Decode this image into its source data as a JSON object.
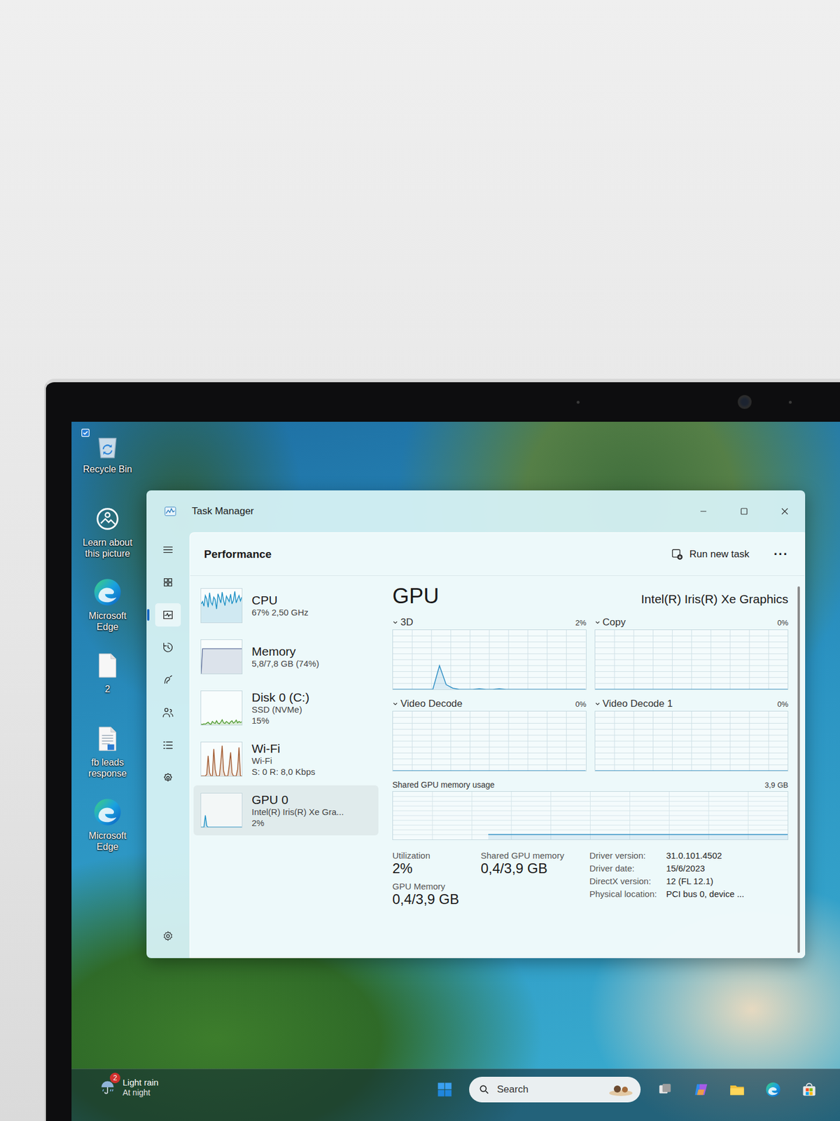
{
  "desktop": {
    "icons": [
      {
        "label": "Recycle Bin",
        "checked": true
      },
      {
        "label": "Learn about this picture",
        "checked": false
      },
      {
        "label": "Microsoft Edge",
        "checked": false
      },
      {
        "label": "2",
        "checked": false
      },
      {
        "label": "fb leads response",
        "checked": false
      },
      {
        "label": "Microsoft Edge",
        "checked": false
      }
    ]
  },
  "window": {
    "title": "Task Manager"
  },
  "nav_rail": [
    {
      "selected": false
    },
    {
      "selected": false
    },
    {
      "selected": true
    },
    {
      "selected": false
    },
    {
      "selected": false
    },
    {
      "selected": false
    },
    {
      "selected": false
    },
    {
      "selected": false
    }
  ],
  "header": {
    "title": "Performance",
    "action": "Run new task",
    "more": "···"
  },
  "resources": [
    {
      "name": "CPU",
      "details": [
        "67% 2,50 GHz"
      ],
      "color": "#1b8fc4",
      "selected": false,
      "values": [
        55,
        62,
        48,
        80,
        70,
        45,
        88,
        60,
        52,
        75,
        68,
        40,
        85,
        72,
        58,
        90,
        65,
        50,
        78,
        70,
        62,
        84,
        55,
        66,
        92,
        58,
        70,
        80,
        64,
        75
      ]
    },
    {
      "name": "Memory",
      "details": [
        "5,8/7,8 GB (74%)"
      ],
      "color": "#5d6f9a",
      "selected": false,
      "values": [
        0,
        74,
        74,
        74,
        74,
        74,
        74,
        74,
        74,
        74,
        74,
        74,
        74,
        74,
        74,
        74,
        74,
        74,
        74,
        74,
        74,
        74,
        74,
        74,
        74,
        74,
        74,
        74,
        74,
        74
      ]
    },
    {
      "name": "Disk 0 (C:)",
      "details": [
        "SSD (NVMe)",
        "15%"
      ],
      "color": "#4f9a2f",
      "selected": false,
      "values": [
        2,
        1,
        3,
        2,
        5,
        8,
        3,
        2,
        10,
        6,
        4,
        12,
        5,
        3,
        8,
        15,
        6,
        4,
        10,
        7,
        3,
        9,
        12,
        5,
        8,
        14,
        6,
        10,
        7,
        9
      ]
    },
    {
      "name": "Wi-Fi",
      "details": [
        "Wi-Fi",
        "S: 0 R: 8,0 Kbps"
      ],
      "color": "#a0562a",
      "selected": false,
      "values": [
        0,
        0,
        0,
        0,
        5,
        60,
        10,
        0,
        0,
        80,
        20,
        0,
        0,
        0,
        40,
        90,
        15,
        0,
        0,
        0,
        30,
        70,
        10,
        0,
        0,
        0,
        20,
        85,
        0,
        0
      ]
    },
    {
      "name": "GPU 0",
      "details": [
        "Intel(R) Iris(R) Xe Gra...",
        "2%"
      ],
      "color": "#1b8fc4",
      "selected": true,
      "values": [
        0,
        0,
        0,
        35,
        4,
        0,
        0,
        0,
        0,
        0,
        0,
        0,
        0,
        0,
        0,
        0,
        0,
        0,
        0,
        0,
        0,
        0,
        0,
        0,
        0,
        0,
        0,
        0,
        0,
        0
      ]
    }
  ],
  "detail": {
    "title": "GPU",
    "device": "Intel(R) Iris(R) Xe Graphics",
    "engines": [
      {
        "label": "3D",
        "reading": "2%",
        "values": [
          0,
          0,
          0,
          0,
          0,
          0,
          0,
          40,
          8,
          2,
          0,
          0,
          0,
          1,
          0,
          0,
          1,
          0,
          0,
          0,
          0,
          0,
          0,
          0,
          0,
          0,
          0,
          0,
          0,
          0
        ]
      },
      {
        "label": "Copy",
        "reading": "0%",
        "values": [
          0,
          0,
          0,
          0,
          0,
          0,
          0,
          0,
          0,
          0,
          0,
          0,
          0,
          0,
          0,
          0,
          0,
          0,
          0,
          0,
          0,
          0,
          0,
          0,
          0,
          0,
          0,
          0,
          0,
          0
        ]
      },
      {
        "label": "Video Decode",
        "reading": "0%",
        "values": [
          0,
          0,
          0,
          0,
          0,
          0,
          0,
          0,
          0,
          0,
          0,
          0,
          0,
          0,
          0,
          0,
          0,
          0,
          0,
          0,
          0,
          0,
          0,
          0,
          0,
          0,
          0,
          0,
          0,
          0
        ]
      },
      {
        "label": "Video Decode 1",
        "reading": "0%",
        "values": [
          0,
          0,
          0,
          0,
          0,
          0,
          0,
          0,
          0,
          0,
          0,
          0,
          0,
          0,
          0,
          0,
          0,
          0,
          0,
          0,
          0,
          0,
          0,
          0,
          0,
          0,
          0,
          0,
          0,
          0
        ]
      }
    ],
    "shared_memory_chart": {
      "label": "Shared GPU memory usage",
      "max_label": "3,9 GB",
      "max": 3.9,
      "values": [
        0.4,
        0.4,
        0.4,
        0.4,
        0.4,
        0.4,
        0.4,
        0.4,
        0.4,
        0.4,
        0.4,
        0.4,
        0.4,
        0.4,
        0.4,
        0.4,
        0.4,
        0.4,
        0.4,
        0.4,
        0.4,
        0.4,
        0.4
      ]
    },
    "stats": [
      [
        {
          "label": "Utilization",
          "value": "2%"
        },
        {
          "label": "GPU Memory",
          "value": "0,4/3,9 GB"
        }
      ],
      [
        {
          "label": "Shared GPU memory",
          "value": "0,4/3,9 GB"
        }
      ]
    ],
    "properties": [
      {
        "label": "Driver version:",
        "value": "31.0.101.4502"
      },
      {
        "label": "Driver date:",
        "value": "15/6/2023"
      },
      {
        "label": "DirectX version:",
        "value": "12 (FL 12.1)"
      },
      {
        "label": "Physical location:",
        "value": "PCI bus 0, device ..."
      }
    ]
  },
  "taskbar": {
    "weather": {
      "badge": "2",
      "condition": "Light rain",
      "time": "At night"
    },
    "search": {
      "placeholder": "Search"
    }
  }
}
